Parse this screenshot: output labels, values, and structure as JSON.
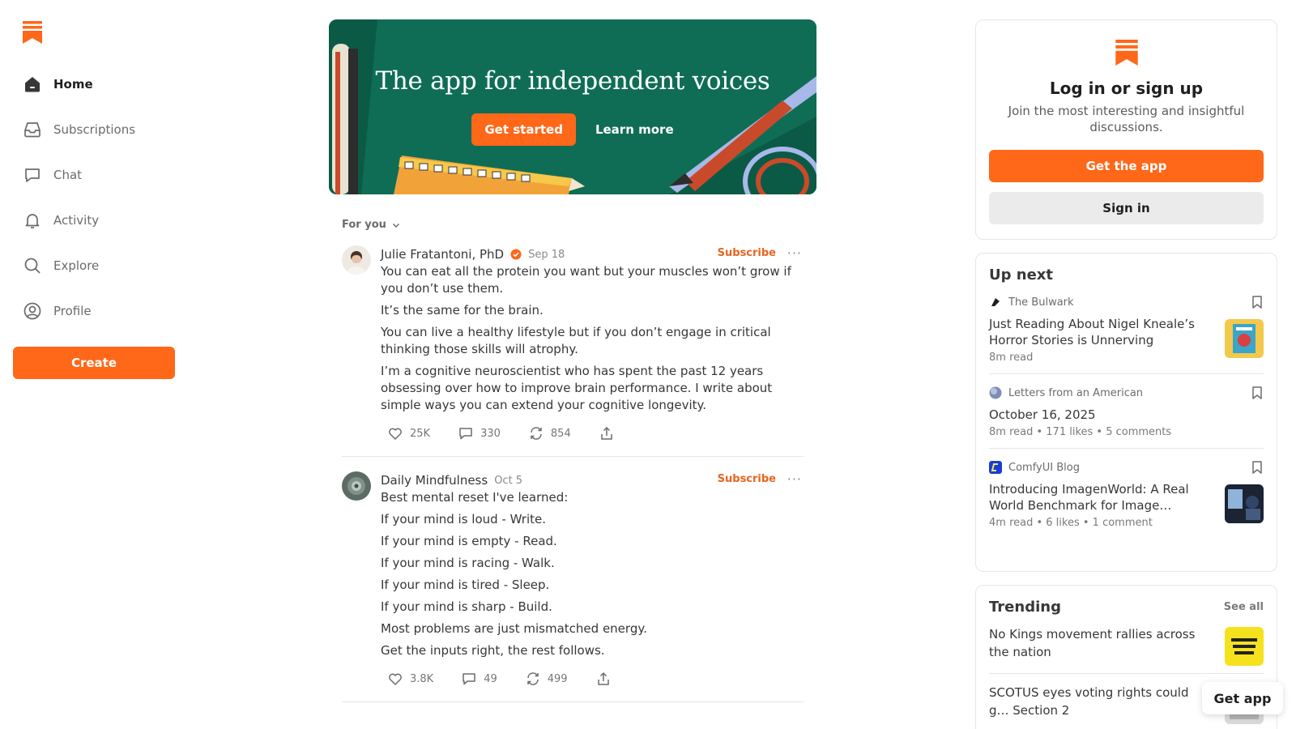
{
  "colors": {
    "brand": "#ff6719",
    "hero_bg": "#0f6d55",
    "text": "#363737",
    "muted": "#7a7a7a"
  },
  "sidebar": {
    "logo_icon": "substack-logo",
    "items": [
      {
        "label": "Home",
        "icon": "home-icon",
        "active": true
      },
      {
        "label": "Subscriptions",
        "icon": "inbox-icon",
        "active": false
      },
      {
        "label": "Chat",
        "icon": "chat-icon",
        "active": false
      },
      {
        "label": "Activity",
        "icon": "bell-icon",
        "active": false
      },
      {
        "label": "Explore",
        "icon": "search-icon",
        "active": false
      },
      {
        "label": "Profile",
        "icon": "profile-icon",
        "active": false
      }
    ],
    "create_label": "Create"
  },
  "hero": {
    "title": "The app for independent voices",
    "primary_label": "Get started",
    "secondary_label": "Learn more"
  },
  "feed": {
    "filter_label": "For you",
    "posts": [
      {
        "author": "Julie Fratantoni, PhD",
        "verified": true,
        "date": "Sep 18",
        "subscribe_label": "Subscribe",
        "paragraphs": [
          "You can eat all the protein you want but your muscles won’t grow if you don’t use them.",
          "It’s the same for the brain.",
          "You can live a healthy lifestyle but if you don’t engage in critical thinking those skills will atrophy.",
          "I’m a cognitive neuroscientist who has spent the past 12 years obsessing over how to improve brain performance. I write about simple ways you can extend your cognitive longevity."
        ],
        "likes": "25K",
        "comments": "330",
        "restacks": "854"
      },
      {
        "author": "Daily Mindfulness",
        "verified": false,
        "date": "Oct 5",
        "subscribe_label": "Subscribe",
        "paragraphs": [
          "Best mental reset I've learned:",
          "If your mind is loud - Write.",
          "If your mind is empty - Read.",
          "If your mind is racing - Walk.",
          "If your mind is tired - Sleep.",
          "If your mind is sharp - Build.",
          "Most problems are just mismatched energy.",
          "Get the inputs right, the rest follows."
        ],
        "likes": "3.8K",
        "comments": "49",
        "restacks": "499"
      }
    ]
  },
  "login": {
    "title": "Log in or sign up",
    "subtitle": "Join the most interesting and insightful discussions.",
    "get_app_label": "Get the app",
    "sign_in_label": "Sign in"
  },
  "up_next": {
    "title": "Up next",
    "items": [
      {
        "publication": "The Bulwark",
        "title": "Just Reading About Nigel Kneale’s Horror Stories is Unnerving",
        "meta": "8m read",
        "has_thumb": true
      },
      {
        "publication": "Letters from an American",
        "title": "October 16, 2025",
        "meta": "8m read • 171 likes • 5 comments",
        "has_thumb": false
      },
      {
        "publication": "ComfyUI Blog",
        "title": "Introducing ImagenWorld: A Real World Benchmark for Image…",
        "meta": "4m read • 6 likes • 1 comment",
        "has_thumb": true
      }
    ]
  },
  "trending": {
    "title": "Trending",
    "see_all_label": "See all",
    "items": [
      {
        "title": "No Kings movement rallies across the nation"
      },
      {
        "title": "SCOTUS eyes voting rights could g… Section 2"
      }
    ]
  },
  "float_get_app_label": "Get app"
}
